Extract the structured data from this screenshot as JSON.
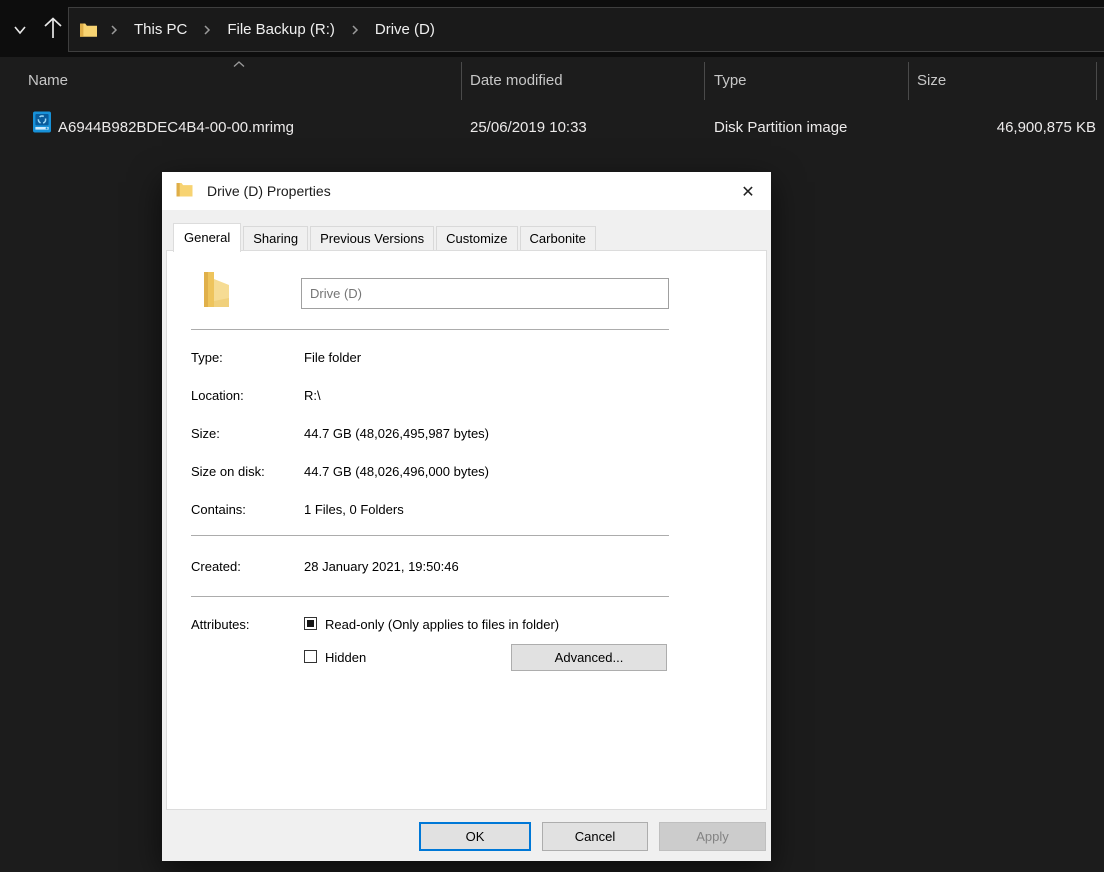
{
  "explorer": {
    "toolbar": {
      "breadcrumb": [
        "This PC",
        "File Backup (R:)",
        "Drive (D)"
      ]
    },
    "columns": {
      "name": "Name",
      "date_modified": "Date modified",
      "type": "Type",
      "size": "Size"
    },
    "file": {
      "name": "A6944B982BDEC4B4-00-00.mrimg",
      "date_modified": "25/06/2019 10:33",
      "type": "Disk Partition image",
      "size": "46,900,875 KB"
    }
  },
  "dialog": {
    "title": "Drive (D) Properties",
    "close_glyph": "✕",
    "tabs": [
      "General",
      "Sharing",
      "Previous Versions",
      "Customize",
      "Carbonite"
    ],
    "name_input": {
      "value": "Drive (D)"
    },
    "rows": [
      {
        "label": "Type:",
        "value": "File folder"
      },
      {
        "label": "Location:",
        "value": "R:\\"
      },
      {
        "label": "Size:",
        "value": "44.7 GB (48,026,495,987 bytes)"
      },
      {
        "label": "Size on disk:",
        "value": "44.7 GB (48,026,496,000 bytes)"
      },
      {
        "label": "Contains:",
        "value": "1 Files, 0 Folders"
      }
    ],
    "created": {
      "label": "Created:",
      "value": "28 January 2021, 19:50:46"
    },
    "attributes": {
      "label": "Attributes:",
      "readonly": {
        "label": "Read-only (Only applies to files in folder)",
        "state": "indeterminate"
      },
      "hidden": {
        "label": "Hidden",
        "state": "unchecked"
      },
      "advanced_label": "Advanced..."
    },
    "footer": {
      "ok": "OK",
      "cancel": "Cancel",
      "apply": "Apply"
    }
  },
  "colors": {
    "accent_blue": "#0078d7",
    "folder_yellow": "#f7d372",
    "drive_icon_blue": "#1791d8",
    "dark_toolbar": "#0d0d0d",
    "dark_content": "#1c1c1c"
  }
}
